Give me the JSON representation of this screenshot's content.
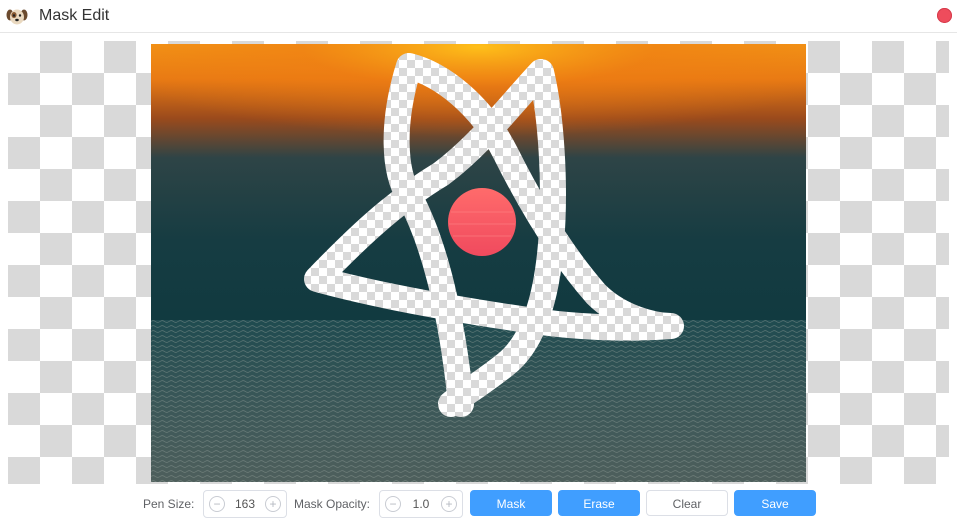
{
  "window": {
    "title": "Mask Edit"
  },
  "colors": {
    "accent": "#409eff",
    "close": "#ee4c5c"
  },
  "icons": {
    "app": "dog-face-icon",
    "close": "close-dot-icon",
    "decrement": "minus-circle-icon",
    "increment": "plus-circle-icon"
  },
  "toolbar": {
    "pen_size_label": "Pen Size:",
    "pen_size_value": "163",
    "mask_opacity_label": "Mask Opacity:",
    "mask_opacity_value": "1.0",
    "decrement_symbol": "−",
    "increment_symbol": "+",
    "mask_label": "Mask",
    "erase_label": "Erase",
    "clear_label": "Clear",
    "save_label": "Save"
  }
}
